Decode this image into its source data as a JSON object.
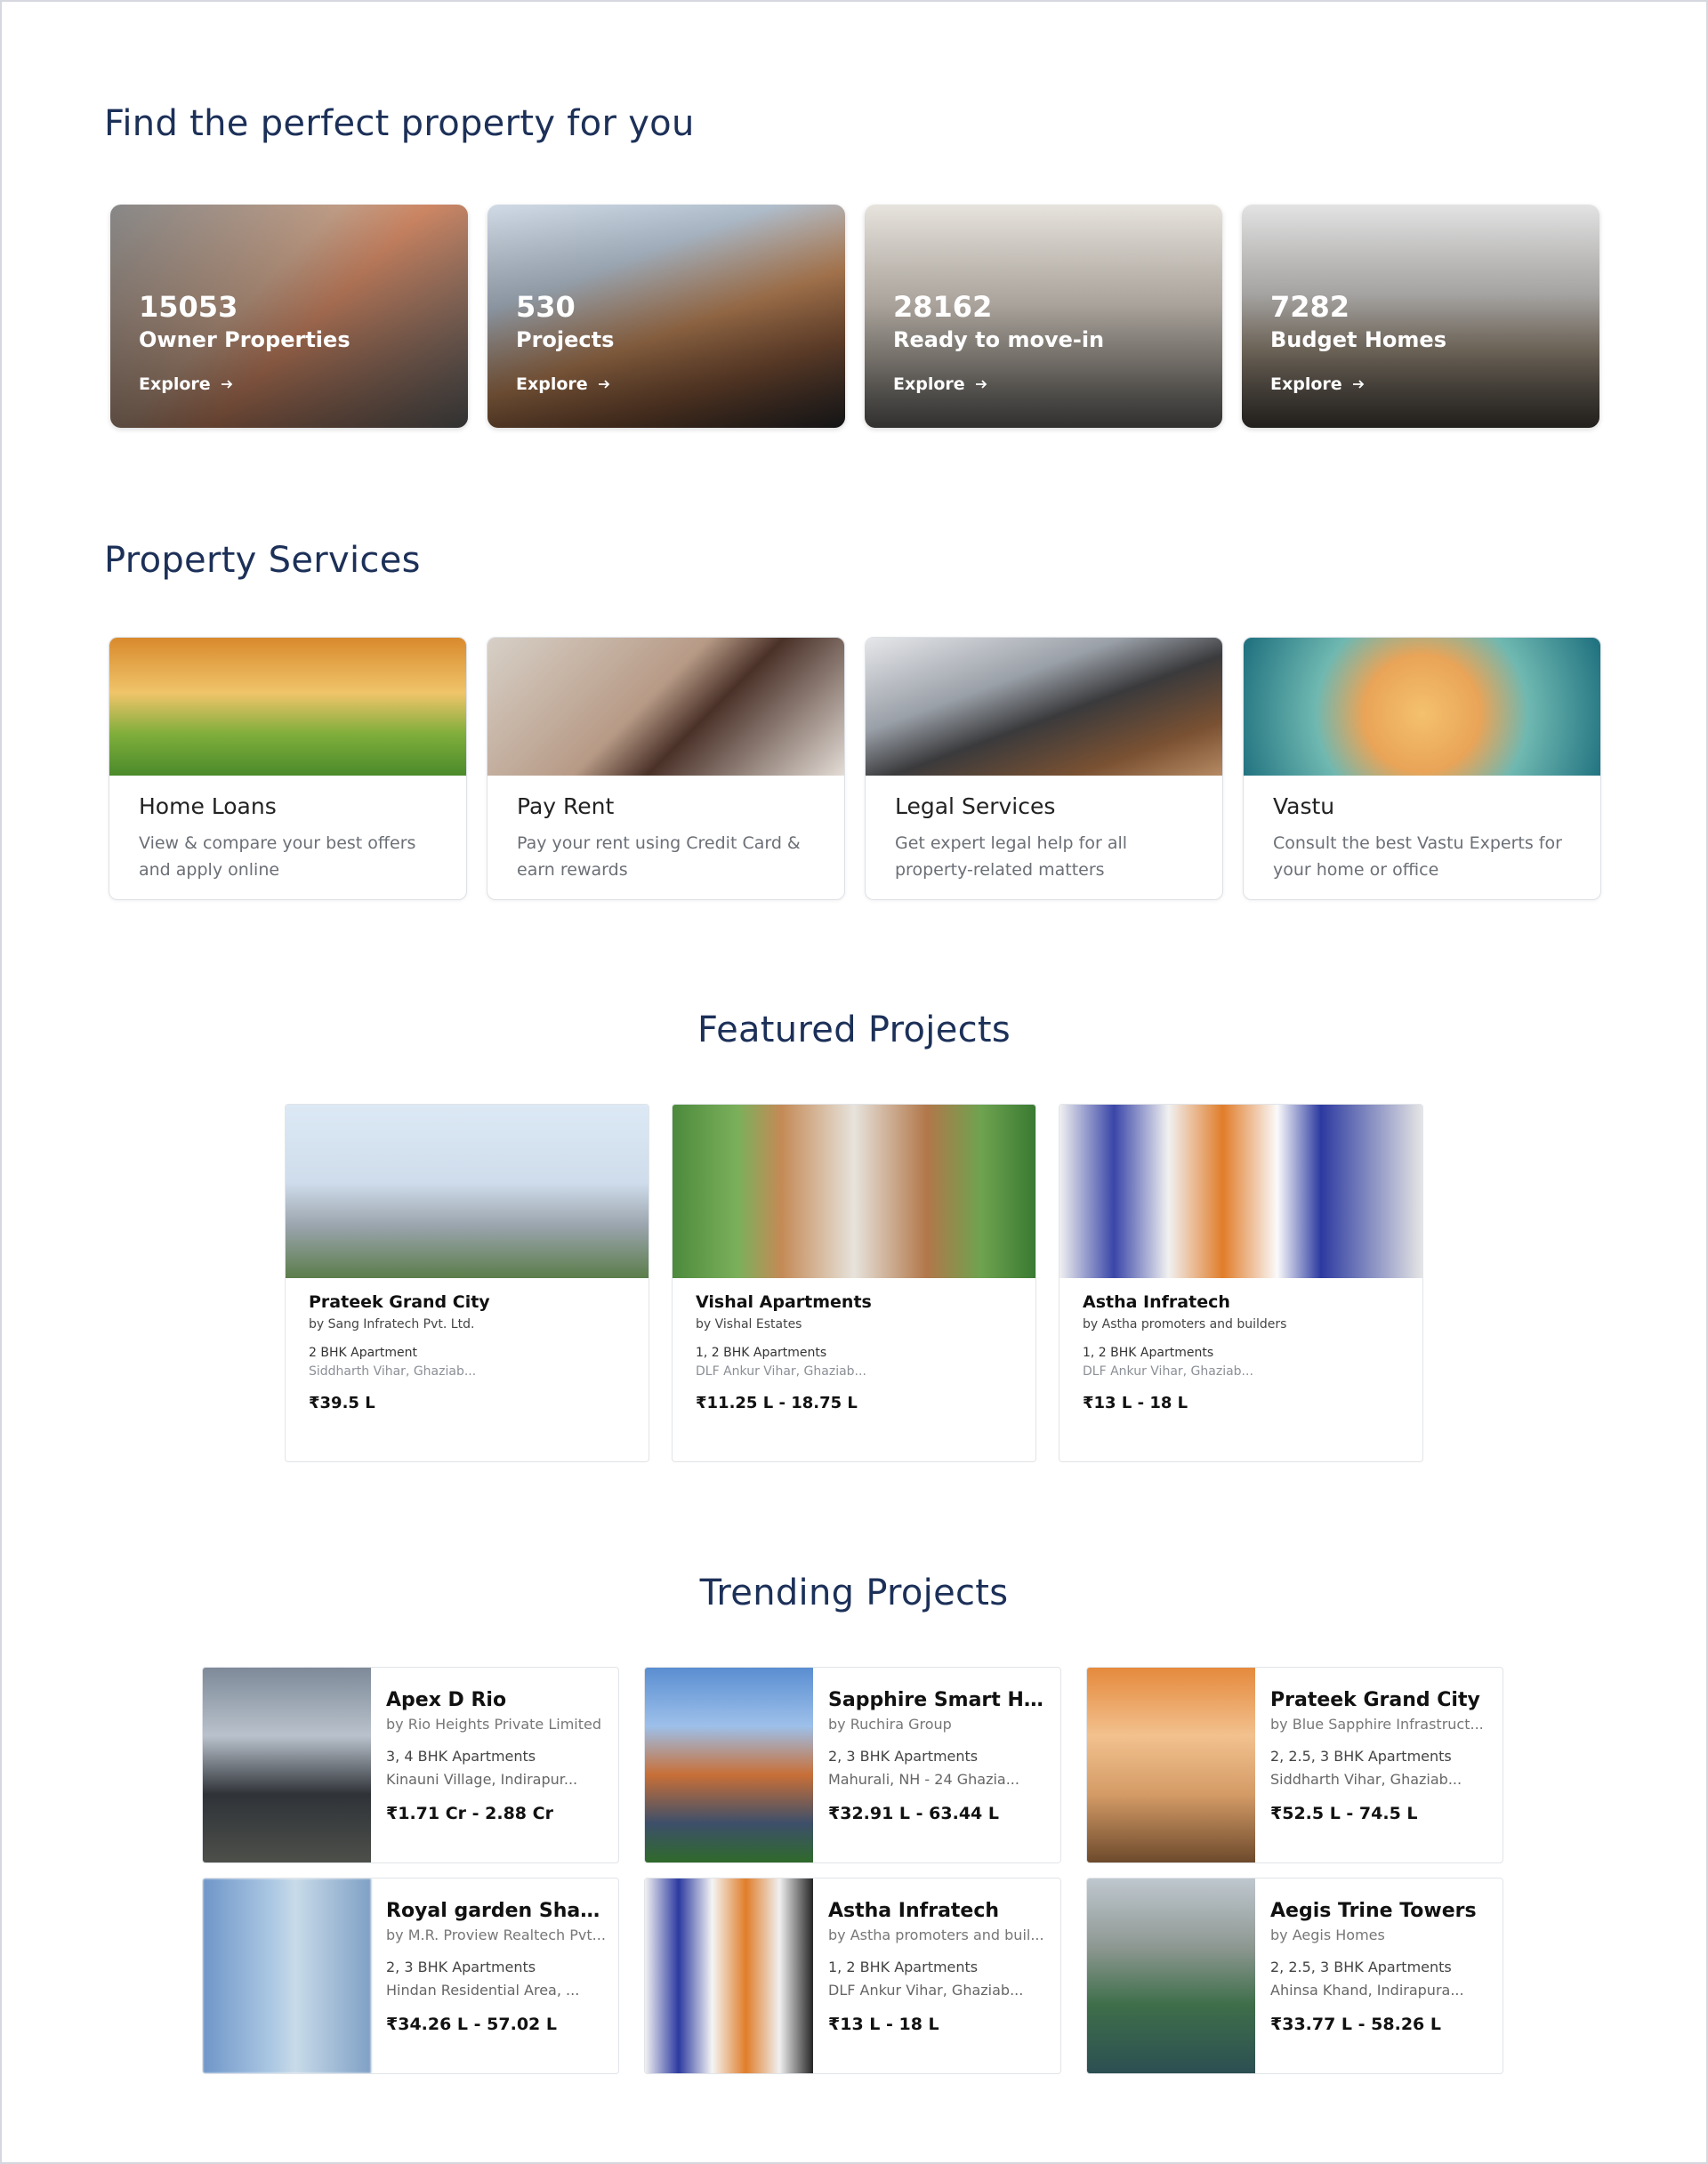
{
  "find": {
    "title": "Find the perfect property for you",
    "cards": [
      {
        "count": "15053",
        "label": "Owner Properties",
        "explore": "Explore"
      },
      {
        "count": "530",
        "label": "Projects",
        "explore": "Explore"
      },
      {
        "count": "28162",
        "label": "Ready to move-in",
        "explore": "Explore"
      },
      {
        "count": "7282",
        "label": "Budget Homes",
        "explore": "Explore"
      }
    ]
  },
  "services": {
    "title": "Property Services",
    "cards": [
      {
        "title": "Home Loans",
        "desc": "View & compare your best offers and apply online"
      },
      {
        "title": "Pay Rent",
        "desc": "Pay your rent using Credit Card & earn rewards"
      },
      {
        "title": "Legal Services",
        "desc": "Get expert legal help for all property-related matters"
      },
      {
        "title": "Vastu",
        "desc": "Consult the best Vastu Experts for your home or office"
      }
    ]
  },
  "featured": {
    "title": "Featured Projects",
    "projects": [
      {
        "name": "Prateek Grand City",
        "by": "by Sang Infratech Pvt. Ltd.",
        "type": "2 BHK Apartment",
        "location": "Siddharth Vihar, Ghaziab...",
        "price": "₹39.5 L"
      },
      {
        "name": "Vishal Apartments",
        "by": "by Vishal Estates",
        "type": "1, 2 BHK Apartments",
        "location": "DLF Ankur Vihar, Ghaziab...",
        "price": "₹11.25 L - 18.75 L"
      },
      {
        "name": "Astha Infratech",
        "by": "by Astha promoters and builders",
        "type": "1, 2 BHK Apartments",
        "location": "DLF Ankur Vihar, Ghaziab...",
        "price": "₹13 L - 18 L"
      }
    ]
  },
  "trending": {
    "title": "Trending Projects",
    "projects": [
      {
        "name": "Apex D Rio",
        "by": "by Rio Heights Private Limited",
        "type": "3, 4 BHK Apartments",
        "location": "Kinauni Village, Indirapur...",
        "price": "₹1.71 Cr - 2.88 Cr"
      },
      {
        "name": "Sapphire Smart Home",
        "by": "by Ruchira Group",
        "type": "2, 3 BHK Apartments",
        "location": "Mahurali, NH - 24 Ghazia...",
        "price": "₹32.91 L - 63.44 L"
      },
      {
        "name": "Prateek Grand City",
        "by": "by Blue Sapphire Infrastruct...",
        "type": "2, 2.5, 3 BHK Apartments",
        "location": "Siddharth Vihar, Ghaziab...",
        "price": "₹52.5 L - 74.5 L"
      },
      {
        "name": "Royal garden Shalim...",
        "by": "by M.R. Proview Realtech Pvt...",
        "type": "2, 3 BHK Apartments",
        "location": "Hindan Residential Area, ...",
        "price": "₹34.26 L - 57.02 L"
      },
      {
        "name": "Astha Infratech",
        "by": "by Astha promoters and buil...",
        "type": "1, 2 BHK Apartments",
        "location": "DLF Ankur Vihar, Ghaziab...",
        "price": "₹13 L - 18 L"
      },
      {
        "name": "Aegis Trine Towers",
        "by": "by Aegis Homes",
        "type": "2, 2.5, 3 BHK Apartments",
        "location": "Ahinsa Khand, Indirapura...",
        "price": "₹33.77 L - 58.26 L"
      }
    ]
  }
}
